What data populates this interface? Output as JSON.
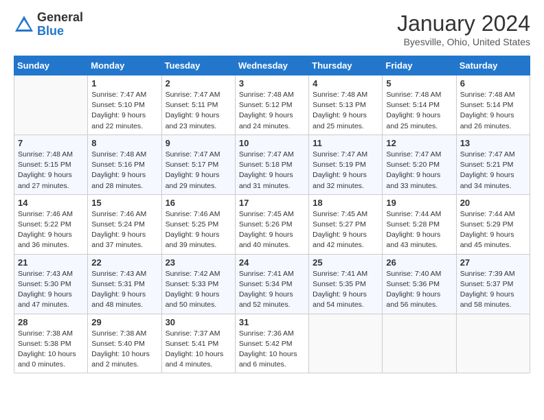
{
  "header": {
    "logo_general": "General",
    "logo_blue": "Blue",
    "month_title": "January 2024",
    "location": "Byesville, Ohio, United States"
  },
  "weekdays": [
    "Sunday",
    "Monday",
    "Tuesday",
    "Wednesday",
    "Thursday",
    "Friday",
    "Saturday"
  ],
  "weeks": [
    [
      {
        "num": "",
        "empty": true
      },
      {
        "num": "1",
        "sunrise": "Sunrise: 7:47 AM",
        "sunset": "Sunset: 5:10 PM",
        "daylight": "Daylight: 9 hours and 22 minutes."
      },
      {
        "num": "2",
        "sunrise": "Sunrise: 7:47 AM",
        "sunset": "Sunset: 5:11 PM",
        "daylight": "Daylight: 9 hours and 23 minutes."
      },
      {
        "num": "3",
        "sunrise": "Sunrise: 7:48 AM",
        "sunset": "Sunset: 5:12 PM",
        "daylight": "Daylight: 9 hours and 24 minutes."
      },
      {
        "num": "4",
        "sunrise": "Sunrise: 7:48 AM",
        "sunset": "Sunset: 5:13 PM",
        "daylight": "Daylight: 9 hours and 25 minutes."
      },
      {
        "num": "5",
        "sunrise": "Sunrise: 7:48 AM",
        "sunset": "Sunset: 5:14 PM",
        "daylight": "Daylight: 9 hours and 25 minutes."
      },
      {
        "num": "6",
        "sunrise": "Sunrise: 7:48 AM",
        "sunset": "Sunset: 5:14 PM",
        "daylight": "Daylight: 9 hours and 26 minutes."
      }
    ],
    [
      {
        "num": "7",
        "sunrise": "Sunrise: 7:48 AM",
        "sunset": "Sunset: 5:15 PM",
        "daylight": "Daylight: 9 hours and 27 minutes."
      },
      {
        "num": "8",
        "sunrise": "Sunrise: 7:48 AM",
        "sunset": "Sunset: 5:16 PM",
        "daylight": "Daylight: 9 hours and 28 minutes."
      },
      {
        "num": "9",
        "sunrise": "Sunrise: 7:47 AM",
        "sunset": "Sunset: 5:17 PM",
        "daylight": "Daylight: 9 hours and 29 minutes."
      },
      {
        "num": "10",
        "sunrise": "Sunrise: 7:47 AM",
        "sunset": "Sunset: 5:18 PM",
        "daylight": "Daylight: 9 hours and 31 minutes."
      },
      {
        "num": "11",
        "sunrise": "Sunrise: 7:47 AM",
        "sunset": "Sunset: 5:19 PM",
        "daylight": "Daylight: 9 hours and 32 minutes."
      },
      {
        "num": "12",
        "sunrise": "Sunrise: 7:47 AM",
        "sunset": "Sunset: 5:20 PM",
        "daylight": "Daylight: 9 hours and 33 minutes."
      },
      {
        "num": "13",
        "sunrise": "Sunrise: 7:47 AM",
        "sunset": "Sunset: 5:21 PM",
        "daylight": "Daylight: 9 hours and 34 minutes."
      }
    ],
    [
      {
        "num": "14",
        "sunrise": "Sunrise: 7:46 AM",
        "sunset": "Sunset: 5:22 PM",
        "daylight": "Daylight: 9 hours and 36 minutes."
      },
      {
        "num": "15",
        "sunrise": "Sunrise: 7:46 AM",
        "sunset": "Sunset: 5:24 PM",
        "daylight": "Daylight: 9 hours and 37 minutes."
      },
      {
        "num": "16",
        "sunrise": "Sunrise: 7:46 AM",
        "sunset": "Sunset: 5:25 PM",
        "daylight": "Daylight: 9 hours and 39 minutes."
      },
      {
        "num": "17",
        "sunrise": "Sunrise: 7:45 AM",
        "sunset": "Sunset: 5:26 PM",
        "daylight": "Daylight: 9 hours and 40 minutes."
      },
      {
        "num": "18",
        "sunrise": "Sunrise: 7:45 AM",
        "sunset": "Sunset: 5:27 PM",
        "daylight": "Daylight: 9 hours and 42 minutes."
      },
      {
        "num": "19",
        "sunrise": "Sunrise: 7:44 AM",
        "sunset": "Sunset: 5:28 PM",
        "daylight": "Daylight: 9 hours and 43 minutes."
      },
      {
        "num": "20",
        "sunrise": "Sunrise: 7:44 AM",
        "sunset": "Sunset: 5:29 PM",
        "daylight": "Daylight: 9 hours and 45 minutes."
      }
    ],
    [
      {
        "num": "21",
        "sunrise": "Sunrise: 7:43 AM",
        "sunset": "Sunset: 5:30 PM",
        "daylight": "Daylight: 9 hours and 47 minutes."
      },
      {
        "num": "22",
        "sunrise": "Sunrise: 7:43 AM",
        "sunset": "Sunset: 5:31 PM",
        "daylight": "Daylight: 9 hours and 48 minutes."
      },
      {
        "num": "23",
        "sunrise": "Sunrise: 7:42 AM",
        "sunset": "Sunset: 5:33 PM",
        "daylight": "Daylight: 9 hours and 50 minutes."
      },
      {
        "num": "24",
        "sunrise": "Sunrise: 7:41 AM",
        "sunset": "Sunset: 5:34 PM",
        "daylight": "Daylight: 9 hours and 52 minutes."
      },
      {
        "num": "25",
        "sunrise": "Sunrise: 7:41 AM",
        "sunset": "Sunset: 5:35 PM",
        "daylight": "Daylight: 9 hours and 54 minutes."
      },
      {
        "num": "26",
        "sunrise": "Sunrise: 7:40 AM",
        "sunset": "Sunset: 5:36 PM",
        "daylight": "Daylight: 9 hours and 56 minutes."
      },
      {
        "num": "27",
        "sunrise": "Sunrise: 7:39 AM",
        "sunset": "Sunset: 5:37 PM",
        "daylight": "Daylight: 9 hours and 58 minutes."
      }
    ],
    [
      {
        "num": "28",
        "sunrise": "Sunrise: 7:38 AM",
        "sunset": "Sunset: 5:38 PM",
        "daylight": "Daylight: 10 hours and 0 minutes."
      },
      {
        "num": "29",
        "sunrise": "Sunrise: 7:38 AM",
        "sunset": "Sunset: 5:40 PM",
        "daylight": "Daylight: 10 hours and 2 minutes."
      },
      {
        "num": "30",
        "sunrise": "Sunrise: 7:37 AM",
        "sunset": "Sunset: 5:41 PM",
        "daylight": "Daylight: 10 hours and 4 minutes."
      },
      {
        "num": "31",
        "sunrise": "Sunrise: 7:36 AM",
        "sunset": "Sunset: 5:42 PM",
        "daylight": "Daylight: 10 hours and 6 minutes."
      },
      {
        "num": "",
        "empty": true
      },
      {
        "num": "",
        "empty": true
      },
      {
        "num": "",
        "empty": true
      }
    ]
  ]
}
